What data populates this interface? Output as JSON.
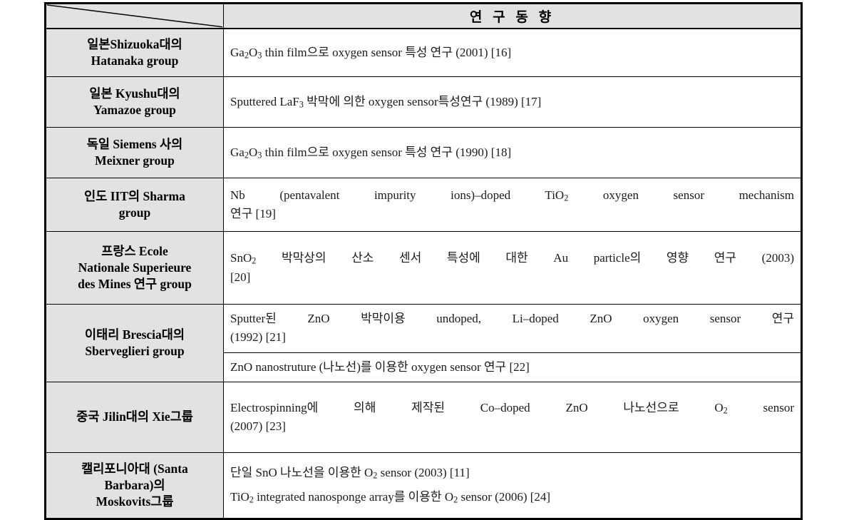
{
  "table": {
    "header": {
      "corner_label": "",
      "trend_column_title": "연 구 동 향"
    },
    "columns": [
      "",
      "연 구 동 향"
    ],
    "rows": [
      {
        "org_lines": [
          "일본Shizuoka대의",
          "Hatanaka group"
        ],
        "trend_lines": [
          "Ga2O3 thin film으로 oxygen sensor 특성 연구 (2001) [16]"
        ]
      },
      {
        "org_lines": [
          "일본 Kyushu대의",
          "Yamazoe group"
        ],
        "trend_lines": [
          "Sputtered LaF3 박막에 의한 oxygen sensor특성연구 (1989) [17]"
        ]
      },
      {
        "org_lines": [
          "독일 Siemens 사의",
          "Meixner group"
        ],
        "trend_lines": [
          "Ga2O3 thin film으로 oxygen sensor 특성 연구 (1990) [18]"
        ]
      },
      {
        "org_lines": [
          "인도 IIT의 Sharma",
          "group"
        ],
        "trend_lines": [
          "Nb (pentavalent impurity ions)-doped TiO2 oxygen sensor mechanism 연구 [19]"
        ]
      },
      {
        "org_lines": [
          "프랑스 Ecole",
          "Nationale Superieure",
          "des Mines 연구 group"
        ],
        "trend_lines": [
          "SnO2 박막상의 산소 센서 특성에 대한 Au particle의 영향 연구 (2003) [20]"
        ]
      },
      {
        "org_lines": [
          "이태리 Brescia대의",
          "Sberveglieri group"
        ],
        "trend_lines": [
          "Sputter된 ZnO 박막이용 undoped, Li-doped ZnO oxygen sensor 연구 (1992) [21]",
          "ZnO nanostruture (나노선)를 이용한 oxygen sensor 연구 [22]"
        ]
      },
      {
        "org_lines": [
          "중국 Jilin대의 Xie그룹"
        ],
        "trend_lines": [
          "Electrospinning에 의해 제작된 Co-doped ZnO 나노선으로 O2 sensor (2007) [23]"
        ]
      },
      {
        "org_lines": [
          "캘리포니아대 (Santa",
          "Barbara)의",
          "Moskovits그룹"
        ],
        "trend_lines": [
          "단일 SnO 나노선을 이용한 O2 sensor (2003) [11]",
          "TiO2 integrated nanosponge array를 이용한 O2 sensor (2006) [24]"
        ]
      }
    ]
  },
  "colors": {
    "header_fill": "#e2e2e2",
    "org_fill": "#e2e2e2",
    "body_fill": "#ffffff",
    "border": "#000000",
    "text": "#000000"
  }
}
